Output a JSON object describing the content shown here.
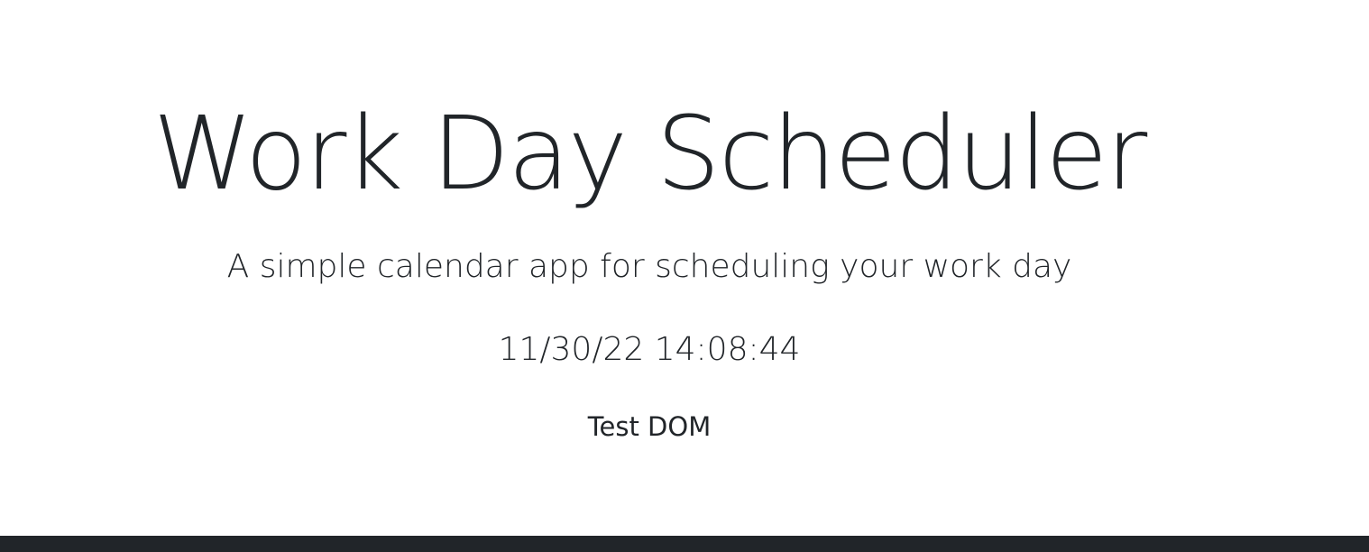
{
  "header": {
    "title": "Work Day Scheduler",
    "subtitle": "A simple calendar app for scheduling your work day",
    "current_day": "11/30/22 14:08:44",
    "test_text": "Test DOM"
  },
  "colors": {
    "text": "#212529",
    "background": "#ffffff",
    "divider": "#212529"
  }
}
